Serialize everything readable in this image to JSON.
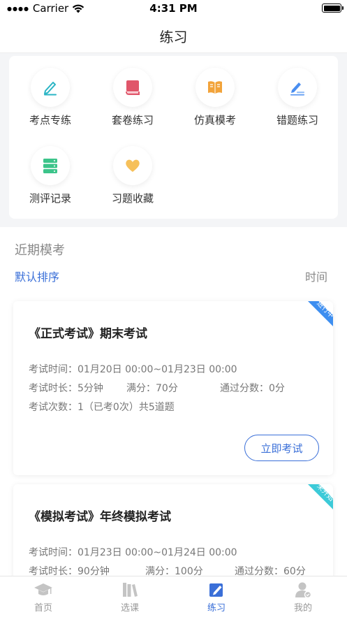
{
  "status_bar": {
    "carrier": "Carrier",
    "time": "4:31 PM"
  },
  "nav": {
    "title": "练习"
  },
  "grid": [
    {
      "label": "考点专练",
      "icon": "pen-icon",
      "color": "#2bb5c5"
    },
    {
      "label": "套卷练习",
      "icon": "book-icon",
      "color": "#e0566a"
    },
    {
      "label": "仿真模考",
      "icon": "open-book-icon",
      "color": "#f2a33a"
    },
    {
      "label": "错题练习",
      "icon": "edit-icon",
      "color": "#4a8ef0"
    },
    {
      "label": "测评记录",
      "icon": "server-icon",
      "color": "#3cc48a"
    },
    {
      "label": "习题收藏",
      "icon": "heart-icon",
      "color": "#f6c05a"
    }
  ],
  "section": {
    "title": "近期模考",
    "sort_default": "默认排序",
    "sort_time": "时间"
  },
  "exams": [
    {
      "title": "《正式考试》期末考试",
      "badge": "进行中",
      "badge_color": "#3d8ef0",
      "time_label": "考试时间：",
      "time_value": "01月20日 00:00~01月23日 00:00",
      "duration": "考试时长：5分钟",
      "full_score": "满分：70分",
      "pass_score": "通过分数：0分",
      "attempts": "考试次数：1（已考0次）共5道题",
      "button": "立即考试"
    },
    {
      "title": "《模拟考试》年终模拟考试",
      "badge": "未开始",
      "badge_color": "#3ccad8",
      "time_label": "考试时间：",
      "time_value": "01月23日 00:00~01月24日 00:00",
      "duration": "考试时长：90分钟",
      "full_score": "满分：100分",
      "pass_score": "通过分数：60分"
    }
  ],
  "tabs": [
    {
      "label": "首页",
      "icon": "graduation-cap-icon"
    },
    {
      "label": "选课",
      "icon": "books-icon"
    },
    {
      "label": "练习",
      "icon": "practice-edit-icon",
      "active": true
    },
    {
      "label": "我的",
      "icon": "user-icon"
    }
  ],
  "colors": {
    "accent": "#3a6fd8",
    "text": "#333333",
    "muted": "#888888"
  }
}
